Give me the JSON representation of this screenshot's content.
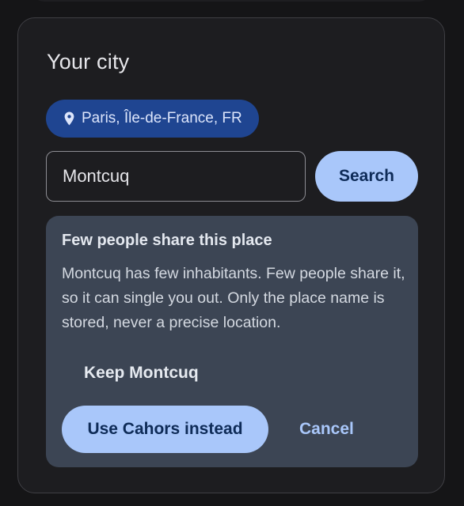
{
  "card": {
    "title": "Your city"
  },
  "location_chip": {
    "icon": "location-pin-icon",
    "label": "Paris, Île-de-France, FR"
  },
  "search": {
    "value": "Montcuq",
    "button_label": "Search"
  },
  "warning": {
    "title": "Few people share this place",
    "body": "Montcuq has few inhabitants. Few people share it, so it can single you out. Only the place name is stored, never a precise location.",
    "keep_label": "Keep Montcuq",
    "use_label": "Use Cahors instead",
    "cancel_label": "Cancel"
  },
  "colors": {
    "background": "#151517",
    "card": "#1d1d20",
    "chip": "#1f4591",
    "accent": "#a9c7fa",
    "warning_panel": "#3c4554"
  }
}
